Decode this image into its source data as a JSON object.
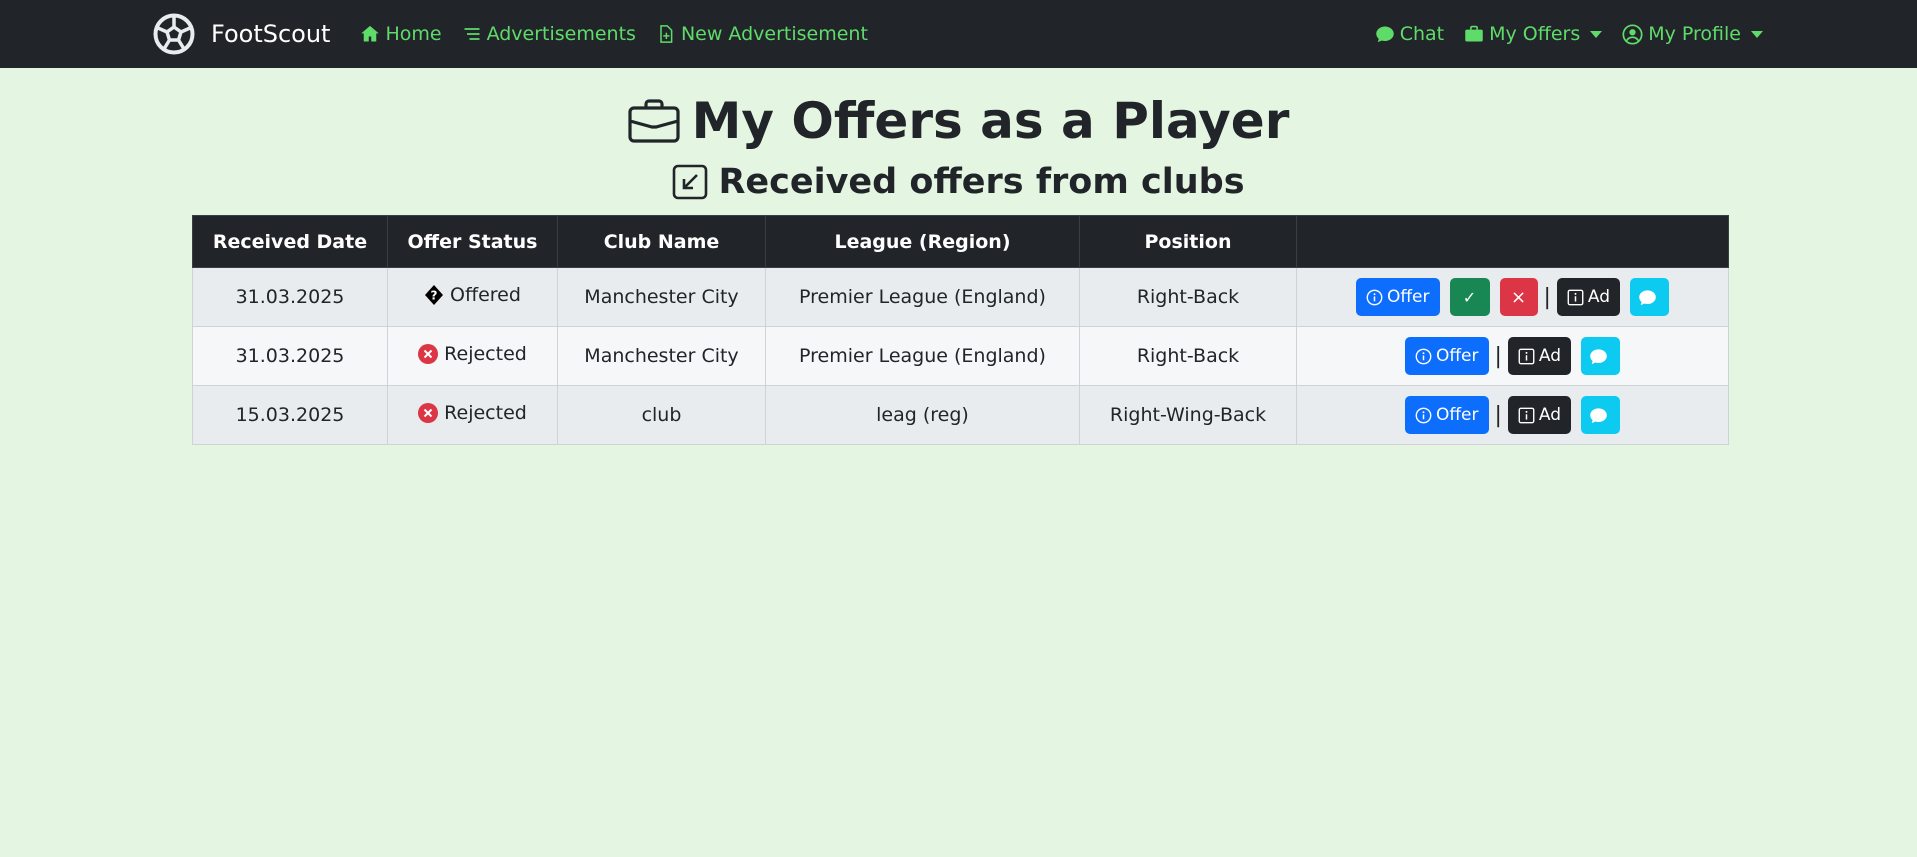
{
  "navbar": {
    "brand": "FootScout",
    "links": {
      "home": "Home",
      "advertisements": "Advertisements",
      "new_advertisement": "New Advertisement",
      "chat": "Chat",
      "my_offers": "My Offers",
      "my_profile": "My Profile"
    },
    "link_color": "#5fdb6a",
    "background": "#212529"
  },
  "page": {
    "title": "My Offers as a Player",
    "subtitle": "Received offers from clubs",
    "background": "#e4f5e2"
  },
  "table": {
    "headers": {
      "received_date": "Received Date",
      "offer_status": "Offer Status",
      "club_name": "Club Name",
      "league_region": "League (Region)",
      "position": "Position",
      "actions": ""
    },
    "rows": [
      {
        "date": "31.03.2025",
        "status": "Offered",
        "status_icon": "unknown-glyph-icon",
        "club": "Manchester City",
        "league": "Premier League (England)",
        "position": "Right-Back",
        "buttons": {
          "offer": "Offer",
          "accept": "✓",
          "reject": "×",
          "separator": "|",
          "ad": "Ad"
        }
      },
      {
        "date": "31.03.2025",
        "status": "Rejected",
        "status_icon": "x-circle-icon",
        "club": "Manchester City",
        "league": "Premier League (England)",
        "position": "Right-Back",
        "buttons": {
          "offer": "Offer",
          "separator": "|",
          "ad": "Ad"
        }
      },
      {
        "date": "15.03.2025",
        "status": "Rejected",
        "status_icon": "x-circle-icon",
        "club": "club",
        "league": "leag (reg)",
        "position": "Right-Wing-Back",
        "buttons": {
          "offer": "Offer",
          "separator": "|",
          "ad": "Ad"
        }
      }
    ]
  },
  "colors": {
    "primary": "#0d6efd",
    "success": "#198754",
    "danger": "#dc3545",
    "dark": "#212529",
    "info": "#0dcaf0"
  }
}
